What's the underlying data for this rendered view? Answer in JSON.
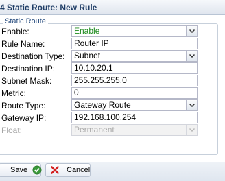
{
  "window": {
    "title": "4 Static Route: New Rule"
  },
  "form": {
    "legend": "Static Route",
    "fields": {
      "enable": {
        "label": "Enable:",
        "value": "Enable"
      },
      "rule_name": {
        "label": "Rule Name:",
        "value": "Router IP"
      },
      "destination_type": {
        "label": "Destination Type:",
        "value": "Subnet"
      },
      "destination_ip": {
        "label": "Destination IP:",
        "value": "10.10.20.1"
      },
      "subnet_mask": {
        "label": "Subnet Mask:",
        "value": "255.255.255.0"
      },
      "metric": {
        "label": "Metric:",
        "value": "0"
      },
      "route_type": {
        "label": "Route Type:",
        "value": "Gateway Route"
      },
      "gateway_ip": {
        "label": "Gateway IP:",
        "value": "192.168.100.254"
      },
      "float": {
        "label": "Float:",
        "value": "Permanent"
      }
    }
  },
  "footer": {
    "save_label": "Save",
    "cancel_label": "Cancel"
  },
  "colors": {
    "enable_value": "#1d8a1d",
    "title_text": "#1f3d66",
    "save_icon": "#3a9a3a",
    "cancel_icon": "#d32020"
  },
  "icons": {
    "save": "check-circle-icon",
    "cancel": "red-x-icon",
    "dropdown": "chevron-down-icon"
  }
}
